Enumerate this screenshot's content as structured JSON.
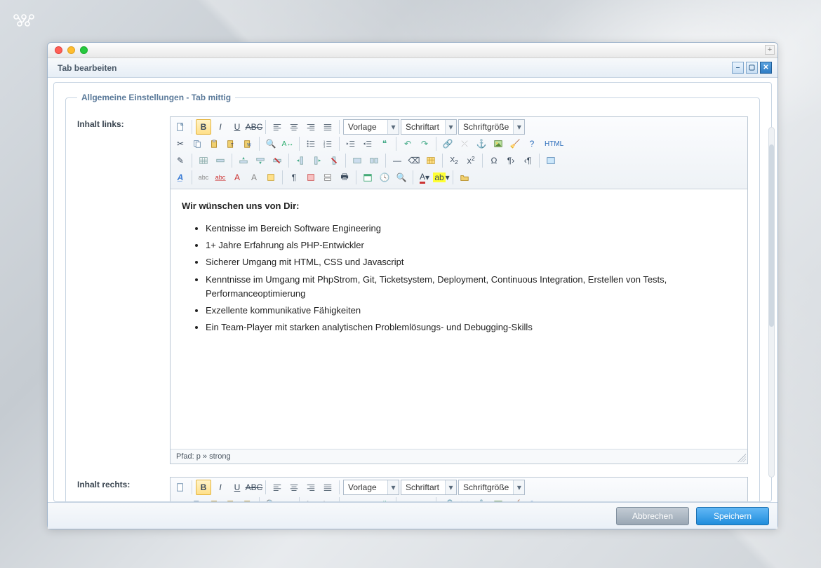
{
  "logo": "app-logo",
  "window": {
    "title": "Tab bearbeiten",
    "section_legend": "Allgemeine Einstellungen - Tab mittig",
    "labels": {
      "left": "Inhalt links:",
      "right": "Inhalt rechts:"
    },
    "toolbar": {
      "dropdowns": {
        "template": "Vorlage",
        "font": "Schriftart",
        "size": "Schriftgröße"
      },
      "html_btn": "HTML"
    },
    "editor_left": {
      "heading": "Wir wünschen uns von Dir:",
      "bullets": [
        "Kentnisse im Bereich Software Engineering",
        "1+ Jahre Erfahrung als PHP-Entwickler",
        "Sicherer Umgang mit HTML, CSS und Javascript",
        "Kenntnisse im Umgang mit PhpStrom, Git, Ticketsystem, Deployment, Continuous Integration, Erstellen von Tests, Performanceoptimierung",
        "Exzellente kommunikative Fähigkeiten",
        "Ein Team-Player mit starken analytischen Problemlösungs- und Debugging-Skills"
      ],
      "path": "Pfad: p » strong"
    },
    "buttons": {
      "cancel": "Abbrechen",
      "save": "Speichern"
    }
  }
}
